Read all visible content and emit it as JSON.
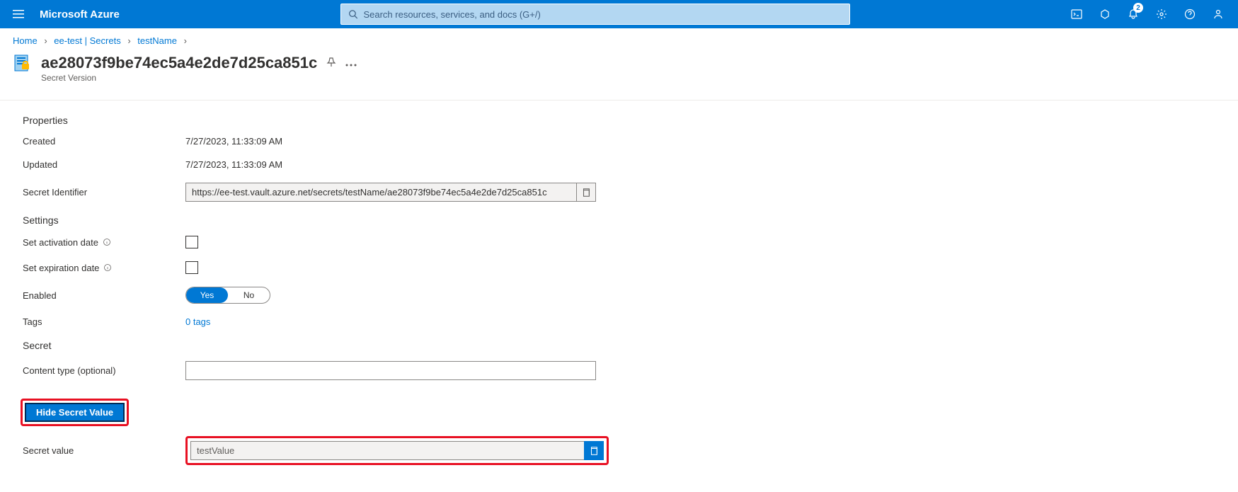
{
  "topbar": {
    "brand": "Microsoft Azure",
    "search_placeholder": "Search resources, services, and docs (G+/)",
    "notification_count": "2"
  },
  "breadcrumb": {
    "home": "Home",
    "kv": "ee-test | Secrets",
    "secret": "testName"
  },
  "page": {
    "title": "ae28073f9be74ec5a4e2de7d25ca851c",
    "subtitle": "Secret Version"
  },
  "sections": {
    "properties": "Properties",
    "settings": "Settings",
    "secret": "Secret"
  },
  "labels": {
    "created": "Created",
    "updated": "Updated",
    "secret_identifier": "Secret Identifier",
    "set_activation": "Set activation date",
    "set_expiration": "Set expiration date",
    "enabled": "Enabled",
    "tags": "Tags",
    "content_type": "Content type (optional)",
    "hide_secret": "Hide Secret Value",
    "secret_value": "Secret value"
  },
  "values": {
    "created": "7/27/2023, 11:33:09 AM",
    "updated": "7/27/2023, 11:33:09 AM",
    "secret_identifier": "https://ee-test.vault.azure.net/secrets/testName/ae28073f9be74ec5a4e2de7d25ca851c",
    "enabled_yes": "Yes",
    "enabled_no": "No",
    "tags": "0 tags",
    "content_type": "",
    "secret_value": "testValue"
  }
}
